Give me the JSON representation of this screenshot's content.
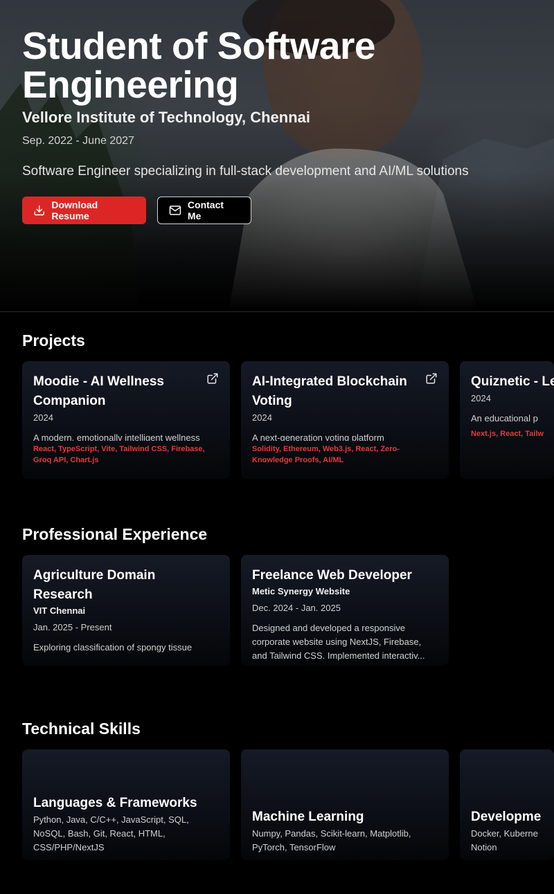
{
  "hero": {
    "title_line1": "Student of Software",
    "title_line2": "Engineering",
    "school": "Vellore Institute of Technology, Chennai",
    "dates": "Sep. 2022 - June 2027",
    "tagline": "Software Engineer specializing in full-stack development and AI/ML solutions",
    "download_label": "Download Resume",
    "contact_label": "Contact Me",
    "accent_color": "#dc2626"
  },
  "projects": {
    "heading": "Projects",
    "items": [
      {
        "title": "Moodie - AI Wellness Companion",
        "year": "2024",
        "description": "A modern, emotionally intelligent wellness",
        "tags": "React, TypeScript, Vite, Tailwind CSS, Firebase, Groq API, Chart.js",
        "icon": "external-link-icon"
      },
      {
        "title": "AI-Integrated Blockchain Voting",
        "year": "2024",
        "description": "A next-generation voting platform",
        "tags": "Solidity, Ethereum, Web3.js, React, Zero-Knowledge Proofs, AI/ML",
        "icon": "external-link-icon"
      },
      {
        "title": "Quiznetic - Learning",
        "year": "2024",
        "description": "An educational p",
        "tags": "Next.js, React, Tailw"
      }
    ]
  },
  "experience": {
    "heading": "Professional Experience",
    "items": [
      {
        "title": "Agriculture Domain Research",
        "org": "VIT Chennai",
        "dates": "Jan. 2025 - Present",
        "description": "Exploring classification of spongy tissue"
      },
      {
        "title": "Freelance Web Developer",
        "org": "Metic Synergy Website",
        "dates": "Dec. 2024 - Jan. 2025",
        "description": "Designed and developed a responsive corporate website using NextJS, Firebase, and Tailwind CSS. Implemented interactiv..."
      }
    ]
  },
  "skills": {
    "heading": "Technical Skills",
    "items": [
      {
        "title": "Languages & Frameworks",
        "items": "Python, Java, C/C++, JavaScript, SQL, NoSQL, Bash, Git, React, HTML, CSS/PHP/NextJS"
      },
      {
        "title": "Machine Learning",
        "items": "Numpy, Pandas, Scikit-learn, Matplotlib, PyTorch, TensorFlow"
      },
      {
        "title": "Developme",
        "items": "Docker, Kuberne Notion"
      }
    ]
  }
}
